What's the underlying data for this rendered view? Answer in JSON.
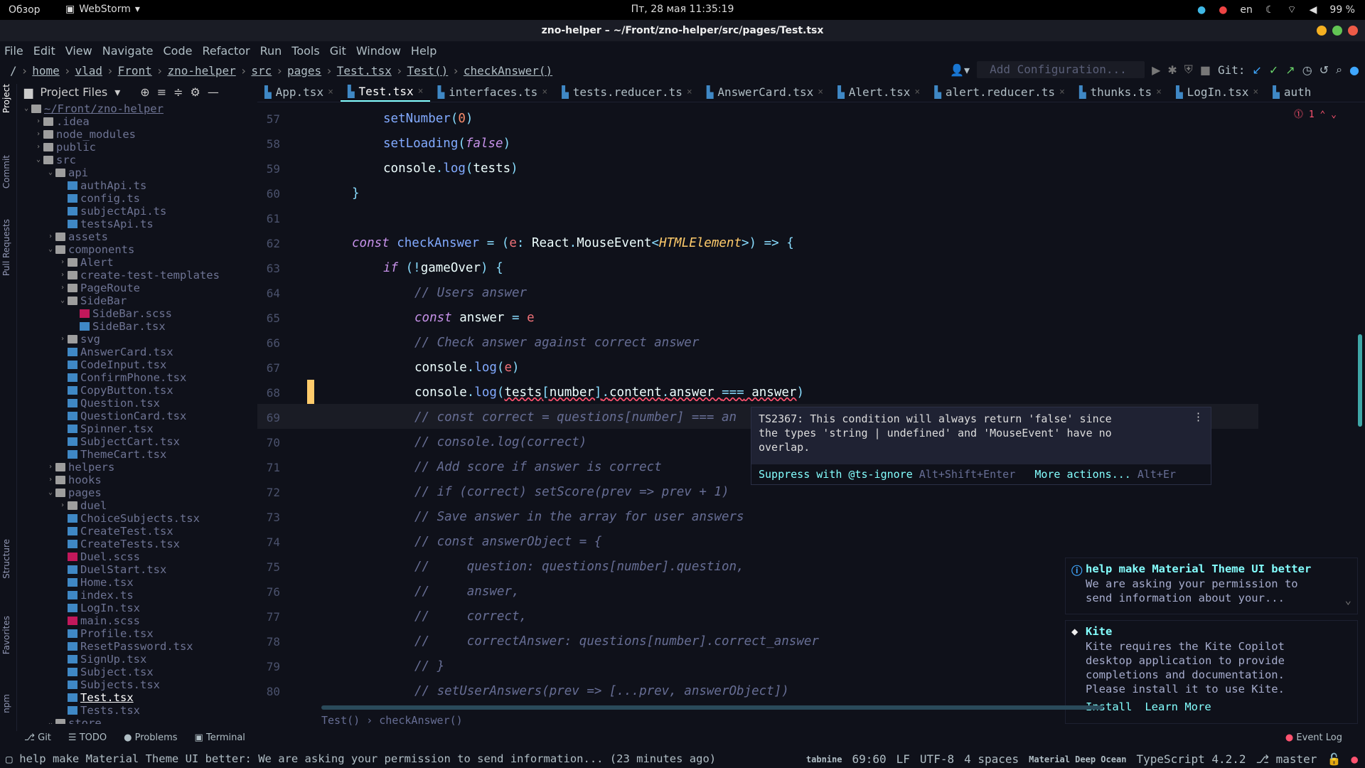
{
  "gnome": {
    "overview": "Обзор",
    "app": "WebStorm",
    "clock": "Пт, 28 мая  11:35:19",
    "lang": "en",
    "battery": "99 %"
  },
  "window": {
    "title": "zno-helper – ~/Front/zno-helper/src/pages/Test.tsx"
  },
  "menu": [
    "File",
    "Edit",
    "View",
    "Navigate",
    "Code",
    "Refactor",
    "Run",
    "Tools",
    "Git",
    "Window",
    "Help"
  ],
  "breadcrumbs": [
    "/",
    "home",
    "vlad",
    "Front",
    "zno-helper",
    "src",
    "pages",
    "Test.tsx",
    "Test()",
    "checkAnswer()"
  ],
  "run": {
    "config_placeholder": "Add Configuration...",
    "git_label": "Git:"
  },
  "left_tools": {
    "project": "Project",
    "commit": "Commit",
    "pull": "Pull Requests",
    "structure": "Structure",
    "favorites": "Favorites",
    "npm": "npm"
  },
  "project": {
    "title": "Project Files",
    "tree": [
      {
        "t": "~/Front/zno-helper",
        "d": 0,
        "k": "open-folder"
      },
      {
        "t": ".idea",
        "d": 1,
        "k": "folder"
      },
      {
        "t": "node_modules",
        "d": 1,
        "k": "folder"
      },
      {
        "t": "public",
        "d": 1,
        "k": "folder"
      },
      {
        "t": "src",
        "d": 1,
        "k": "open-folder"
      },
      {
        "t": "api",
        "d": 2,
        "k": "open-folder"
      },
      {
        "t": "authApi.ts",
        "d": 3,
        "k": "ts"
      },
      {
        "t": "config.ts",
        "d": 3,
        "k": "ts"
      },
      {
        "t": "subjectApi.ts",
        "d": 3,
        "k": "ts"
      },
      {
        "t": "testsApi.ts",
        "d": 3,
        "k": "ts"
      },
      {
        "t": "assets",
        "d": 2,
        "k": "folder"
      },
      {
        "t": "components",
        "d": 2,
        "k": "open-folder"
      },
      {
        "t": "Alert",
        "d": 3,
        "k": "folder"
      },
      {
        "t": "create-test-templates",
        "d": 3,
        "k": "folder"
      },
      {
        "t": "PageRoute",
        "d": 3,
        "k": "folder"
      },
      {
        "t": "SideBar",
        "d": 3,
        "k": "open-folder"
      },
      {
        "t": "SideBar.scss",
        "d": 4,
        "k": "css"
      },
      {
        "t": "SideBar.tsx",
        "d": 4,
        "k": "ts"
      },
      {
        "t": "svg",
        "d": 3,
        "k": "folder"
      },
      {
        "t": "AnswerCard.tsx",
        "d": 3,
        "k": "ts"
      },
      {
        "t": "CodeInput.tsx",
        "d": 3,
        "k": "ts"
      },
      {
        "t": "ConfirmPhone.tsx",
        "d": 3,
        "k": "ts"
      },
      {
        "t": "CopyButton.tsx",
        "d": 3,
        "k": "ts"
      },
      {
        "t": "Question.tsx",
        "d": 3,
        "k": "ts"
      },
      {
        "t": "QuestionCard.tsx",
        "d": 3,
        "k": "ts"
      },
      {
        "t": "Spinner.tsx",
        "d": 3,
        "k": "ts"
      },
      {
        "t": "SubjectCart.tsx",
        "d": 3,
        "k": "ts"
      },
      {
        "t": "ThemeCart.tsx",
        "d": 3,
        "k": "ts"
      },
      {
        "t": "helpers",
        "d": 2,
        "k": "folder"
      },
      {
        "t": "hooks",
        "d": 2,
        "k": "folder"
      },
      {
        "t": "pages",
        "d": 2,
        "k": "open-folder"
      },
      {
        "t": "duel",
        "d": 3,
        "k": "folder"
      },
      {
        "t": "ChoiceSubjects.tsx",
        "d": 3,
        "k": "ts"
      },
      {
        "t": "CreateTest.tsx",
        "d": 3,
        "k": "ts"
      },
      {
        "t": "CreateTests.tsx",
        "d": 3,
        "k": "ts"
      },
      {
        "t": "Duel.scss",
        "d": 3,
        "k": "css"
      },
      {
        "t": "DuelStart.tsx",
        "d": 3,
        "k": "ts"
      },
      {
        "t": "Home.tsx",
        "d": 3,
        "k": "ts"
      },
      {
        "t": "index.ts",
        "d": 3,
        "k": "ts"
      },
      {
        "t": "LogIn.tsx",
        "d": 3,
        "k": "ts"
      },
      {
        "t": "main.scss",
        "d": 3,
        "k": "css"
      },
      {
        "t": "Profile.tsx",
        "d": 3,
        "k": "ts"
      },
      {
        "t": "ResetPassword.tsx",
        "d": 3,
        "k": "ts"
      },
      {
        "t": "SignUp.tsx",
        "d": 3,
        "k": "ts"
      },
      {
        "t": "Subject.tsx",
        "d": 3,
        "k": "ts"
      },
      {
        "t": "Subjects.tsx",
        "d": 3,
        "k": "ts"
      },
      {
        "t": "Test.tsx",
        "d": 3,
        "k": "ts",
        "sel": true
      },
      {
        "t": "Tests.tsx",
        "d": 3,
        "k": "ts"
      },
      {
        "t": "store",
        "d": 2,
        "k": "open-folder"
      }
    ]
  },
  "tabs": [
    {
      "label": "App.tsx"
    },
    {
      "label": "Test.tsx",
      "active": true
    },
    {
      "label": "interfaces.ts"
    },
    {
      "label": "tests.reducer.ts"
    },
    {
      "label": "AnswerCard.tsx"
    },
    {
      "label": "Alert.tsx"
    },
    {
      "label": "alert.reducer.ts"
    },
    {
      "label": "thunks.ts"
    },
    {
      "label": "LogIn.tsx"
    },
    {
      "label": "auth"
    }
  ],
  "errors": "1",
  "code": [
    {
      "n": "57",
      "i": 1,
      "h": "<span class='fn'>setNumber</span><span class='pu'>(</span><span class='num'>0</span><span class='pu'>)</span>"
    },
    {
      "n": "58",
      "i": 1,
      "h": "<span class='fn'>setLoading</span><span class='pu'>(</span><span class='kw'>false</span><span class='pu'>)</span>"
    },
    {
      "n": "59",
      "i": 1,
      "h": "console<span class='pu'>.</span><span class='fn'>log</span><span class='pu'>(</span>tests<span class='pu'>)</span>"
    },
    {
      "n": "60",
      "i": 0,
      "h": "<span class='pu'>}</span>"
    },
    {
      "n": "61",
      "i": 0,
      "h": ""
    },
    {
      "n": "62",
      "i": 0,
      "h": "<span class='kw'>const</span> <span class='fn'>checkAnswer</span> <span class='pu'>=</span> <span class='pu'>(</span><span class='var'>e</span><span class='pu'>:</span> React<span class='pu'>.</span>MouseEvent<span class='pu'>&lt;</span><span class='ty'>HTMLElement</span><span class='pu'>&gt;)</span> <span class='pu'>=&gt;</span> <span class='pu'>{</span>"
    },
    {
      "n": "63",
      "i": 1,
      "h": "<span class='kw'>if</span> <span class='pu'>(!</span>gameOver<span class='pu'>)</span> <span class='pu'>{</span>"
    },
    {
      "n": "64",
      "i": 2,
      "h": "<span class='cm'>// Users answer</span>"
    },
    {
      "n": "65",
      "i": 2,
      "h": "<span class='kw'>const</span> answer <span class='pu'>=</span> <span class='var'>e</span>"
    },
    {
      "n": "66",
      "i": 2,
      "h": "<span class='cm'>// Check answer against correct answer</span>"
    },
    {
      "n": "67",
      "i": 2,
      "h": "console<span class='pu'>.</span><span class='fn'>log</span><span class='pu'>(</span><span class='var'>e</span><span class='pu'>)</span>"
    },
    {
      "n": "68",
      "i": 2,
      "h": "console<span class='pu'>.</span><span class='fn'>log</span><span class='pu'>(</span><span style='text-decoration:underline wavy #ff5370'>tests<span class='pu'>[</span>number<span class='pu'>]</span><span class='pu'>.</span>content<span class='pu'>.</span>answer <span class='pu'>===</span> answer</span><span class='pu'>)</span>"
    },
    {
      "n": "69",
      "i": 2,
      "h": "<span class='cm'>// const correct = questions[number] === an</span>"
    },
    {
      "n": "70",
      "i": 2,
      "h": "<span class='cm'>// console.log(correct)</span>"
    },
    {
      "n": "71",
      "i": 2,
      "h": "<span class='cm'>// Add score if answer is correct</span>"
    },
    {
      "n": "72",
      "i": 2,
      "h": "<span class='cm'>// if (correct) setScore(prev =&gt; prev + 1)</span>"
    },
    {
      "n": "73",
      "i": 2,
      "h": "<span class='cm'>// Save answer in the array for user answers</span>"
    },
    {
      "n": "74",
      "i": 2,
      "h": "<span class='cm'>// const answerObject = {</span>"
    },
    {
      "n": "75",
      "i": 2,
      "h": "<span class='cm'>//     question: questions[number].question,</span>"
    },
    {
      "n": "76",
      "i": 2,
      "h": "<span class='cm'>//     answer,</span>"
    },
    {
      "n": "77",
      "i": 2,
      "h": "<span class='cm'>//     correct,</span>"
    },
    {
      "n": "78",
      "i": 2,
      "h": "<span class='cm'>//     correctAnswer: questions[number].correct_answer</span>"
    },
    {
      "n": "79",
      "i": 2,
      "h": "<span class='cm'>// }</span>"
    },
    {
      "n": "80",
      "i": 2,
      "h": "<span class='cm'>// setUserAnswers(prev =&gt; [...prev, answerObject])</span>"
    }
  ],
  "tooltip": {
    "message": "TS2367: This condition will always return 'false' since\nthe types 'string | undefined' and 'MouseEvent' have no\noverlap.",
    "suppress": "Suppress with @ts-ignore",
    "suppress_key": "Alt+Shift+Enter",
    "more": "More actions...",
    "more_key": "Alt+Er"
  },
  "notifications": [
    {
      "title": "help make Material Theme UI better",
      "body": "We are asking your permission to\nsend information about your..."
    },
    {
      "title": "Kite",
      "body": "Kite requires the Kite Copilot\ndesktop application to provide\ncompletions and documentation.\nPlease install it to use Kite.",
      "links": [
        "Install",
        "Learn More"
      ]
    }
  ],
  "editor_breadcrumb": "Test()  ›  checkAnswer()",
  "bottom_tabs": [
    "Git",
    "TODO",
    "Problems",
    "Terminal"
  ],
  "event_log": "Event Log",
  "status": {
    "message": "help make Material Theme UI better: We are asking your permission to send information... (23 minutes ago)",
    "tabnine": "tabnine",
    "pos": "69:60",
    "eol": "LF",
    "enc": "UTF-8",
    "indent": "4 spaces",
    "theme": "Material Deep Ocean",
    "lang": "TypeScript 4.2.2",
    "branch": "master"
  },
  "colors": {
    "accent": "#84ffff",
    "bg": "#0f111a"
  }
}
